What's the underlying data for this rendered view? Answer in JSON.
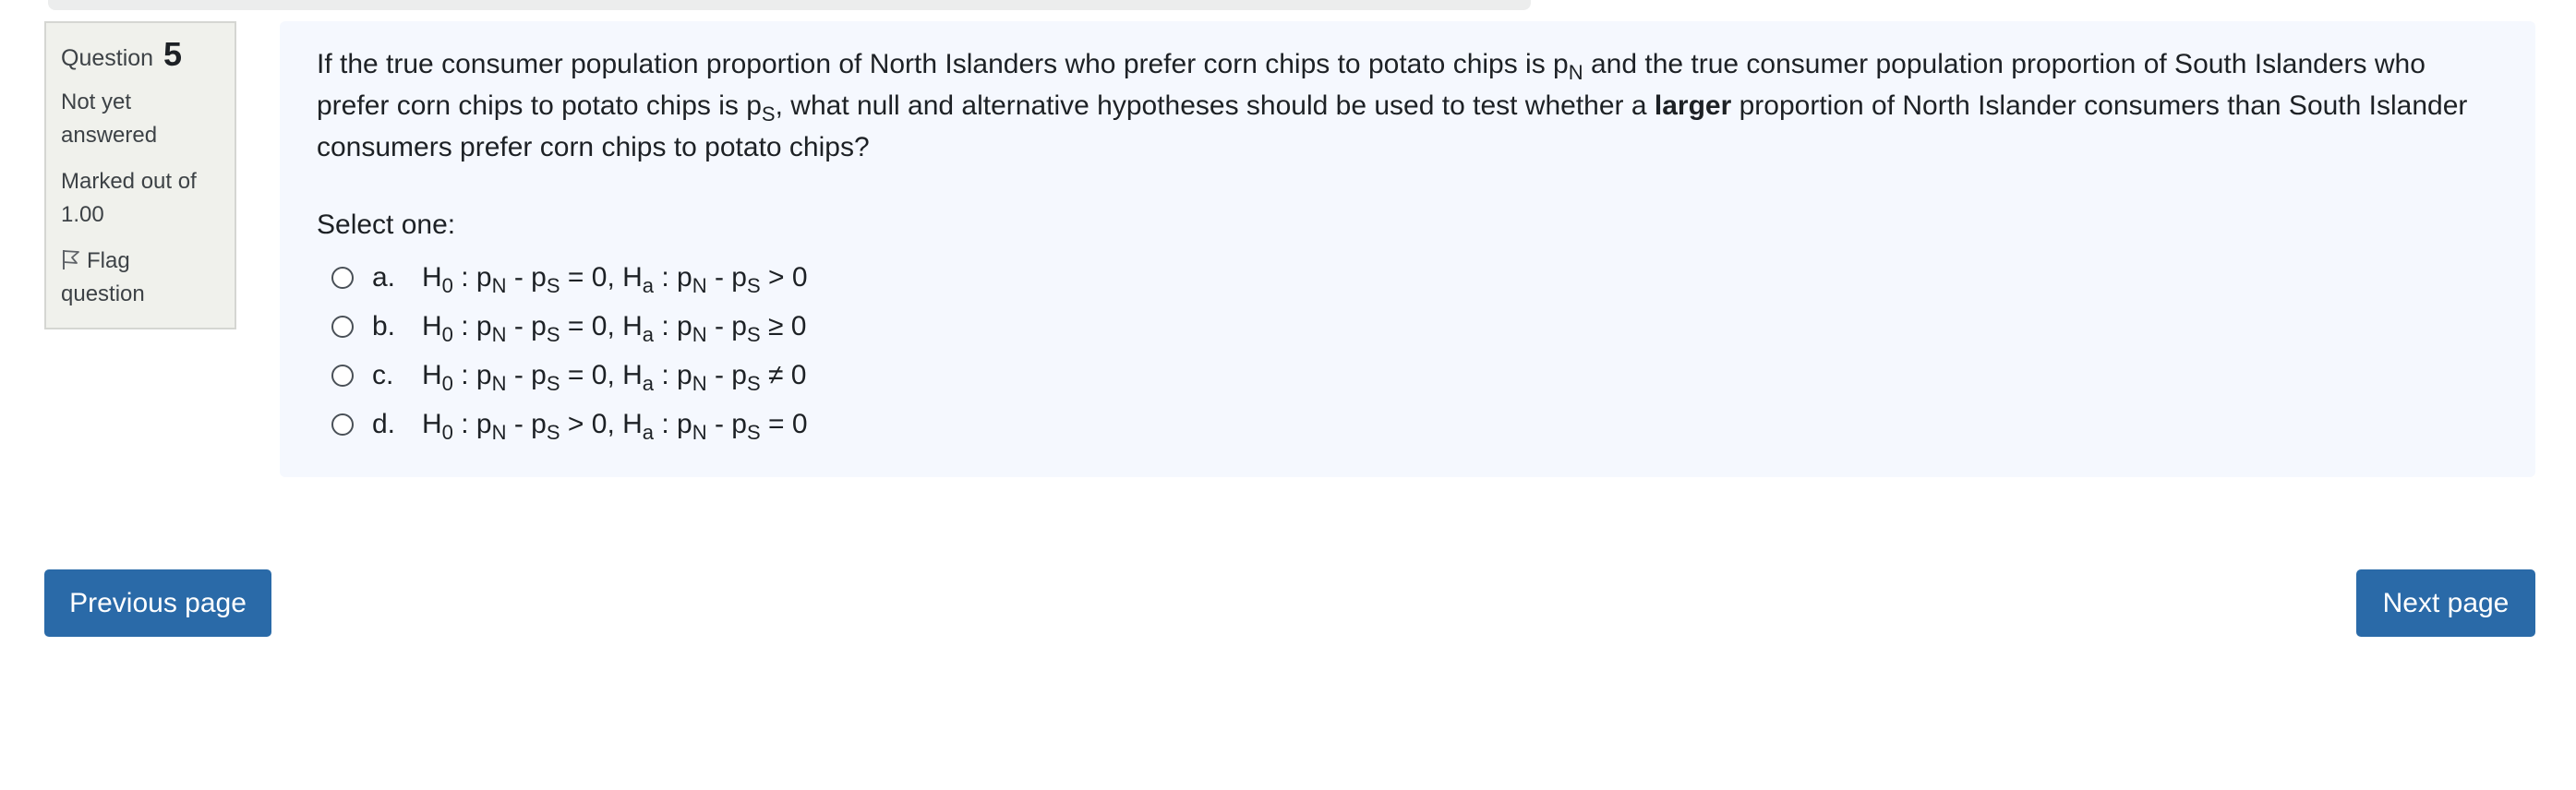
{
  "question_info": {
    "label": "Question",
    "number": "5",
    "state": "Not yet answered",
    "mark": "Marked out of 1.00",
    "flag_label": "Flag question",
    "flag_icon": "flag-icon"
  },
  "question": {
    "text_1": "If the true consumer population proportion of North Islanders who prefer corn chips to potato chips is p",
    "sub_1": "N",
    "text_2": " and the true consumer population proportion of South Islanders who prefer corn chips to potato chips is p",
    "sub_2": "S",
    "text_3": ", what null and alternative hypotheses should be used to test whether a ",
    "emphasis": "larger",
    "text_4": " proportion of North Islander consumers than South Islander consumers prefer corn chips to potato chips?",
    "prompt": "Select one:"
  },
  "hypothesis_parts": {
    "H": "H",
    "zero_sub": "0",
    "a_sub": "a",
    "colon_p": " : p",
    "N": "N",
    "S": "S",
    "minus_p": " - p",
    "sep": ", H"
  },
  "answers": [
    {
      "letter": "a.",
      "h0_rel": " = 0",
      "ha_rel": " > 0"
    },
    {
      "letter": "b.",
      "h0_rel": " = 0",
      "ha_rel": " ≥ 0"
    },
    {
      "letter": "c.",
      "h0_rel": " = 0",
      "ha_rel": " ≠ 0"
    },
    {
      "letter": "d.",
      "h0_rel": " > 0",
      "ha_rel": " = 0"
    }
  ],
  "navigation": {
    "previous": "Previous page",
    "next": "Next page"
  },
  "colors": {
    "button": "#2a6aa8",
    "info_box": "#f0f1ec",
    "content_box": "#f5f8fe"
  }
}
